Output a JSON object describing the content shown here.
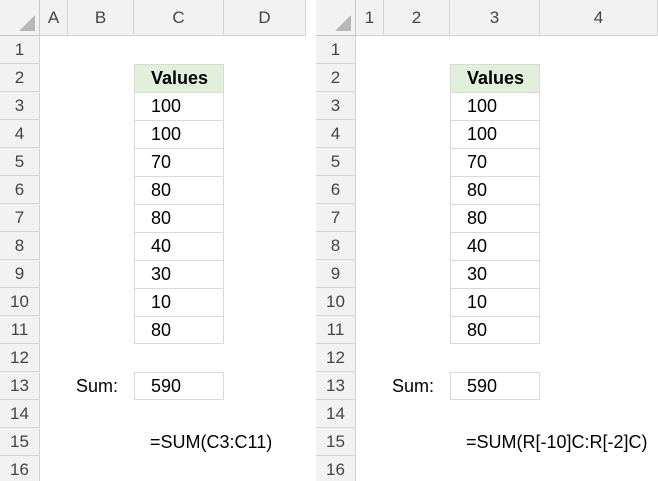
{
  "left_sheet": {
    "columns": [
      "A",
      "B",
      "C",
      "D"
    ],
    "rows": [
      "1",
      "2",
      "3",
      "4",
      "5",
      "6",
      "7",
      "8",
      "9",
      "10",
      "11",
      "12",
      "13",
      "14",
      "15",
      "16"
    ],
    "header": "Values",
    "values": [
      "100",
      "100",
      "70",
      "80",
      "80",
      "40",
      "30",
      "10",
      "80"
    ],
    "sum_label": "Sum:",
    "sum_value": "590",
    "formula": "=SUM(C3:C11)"
  },
  "right_sheet": {
    "columns": [
      "1",
      "2",
      "3",
      "4"
    ],
    "rows": [
      "1",
      "2",
      "3",
      "4",
      "5",
      "6",
      "7",
      "8",
      "9",
      "10",
      "11",
      "12",
      "13",
      "14",
      "15",
      "16"
    ],
    "header": "Values",
    "values": [
      "100",
      "100",
      "70",
      "80",
      "80",
      "40",
      "30",
      "10",
      "80"
    ],
    "sum_label": "Sum:",
    "sum_value": "590",
    "formula": "=SUM(R[-10]C:R[-2]C)"
  }
}
